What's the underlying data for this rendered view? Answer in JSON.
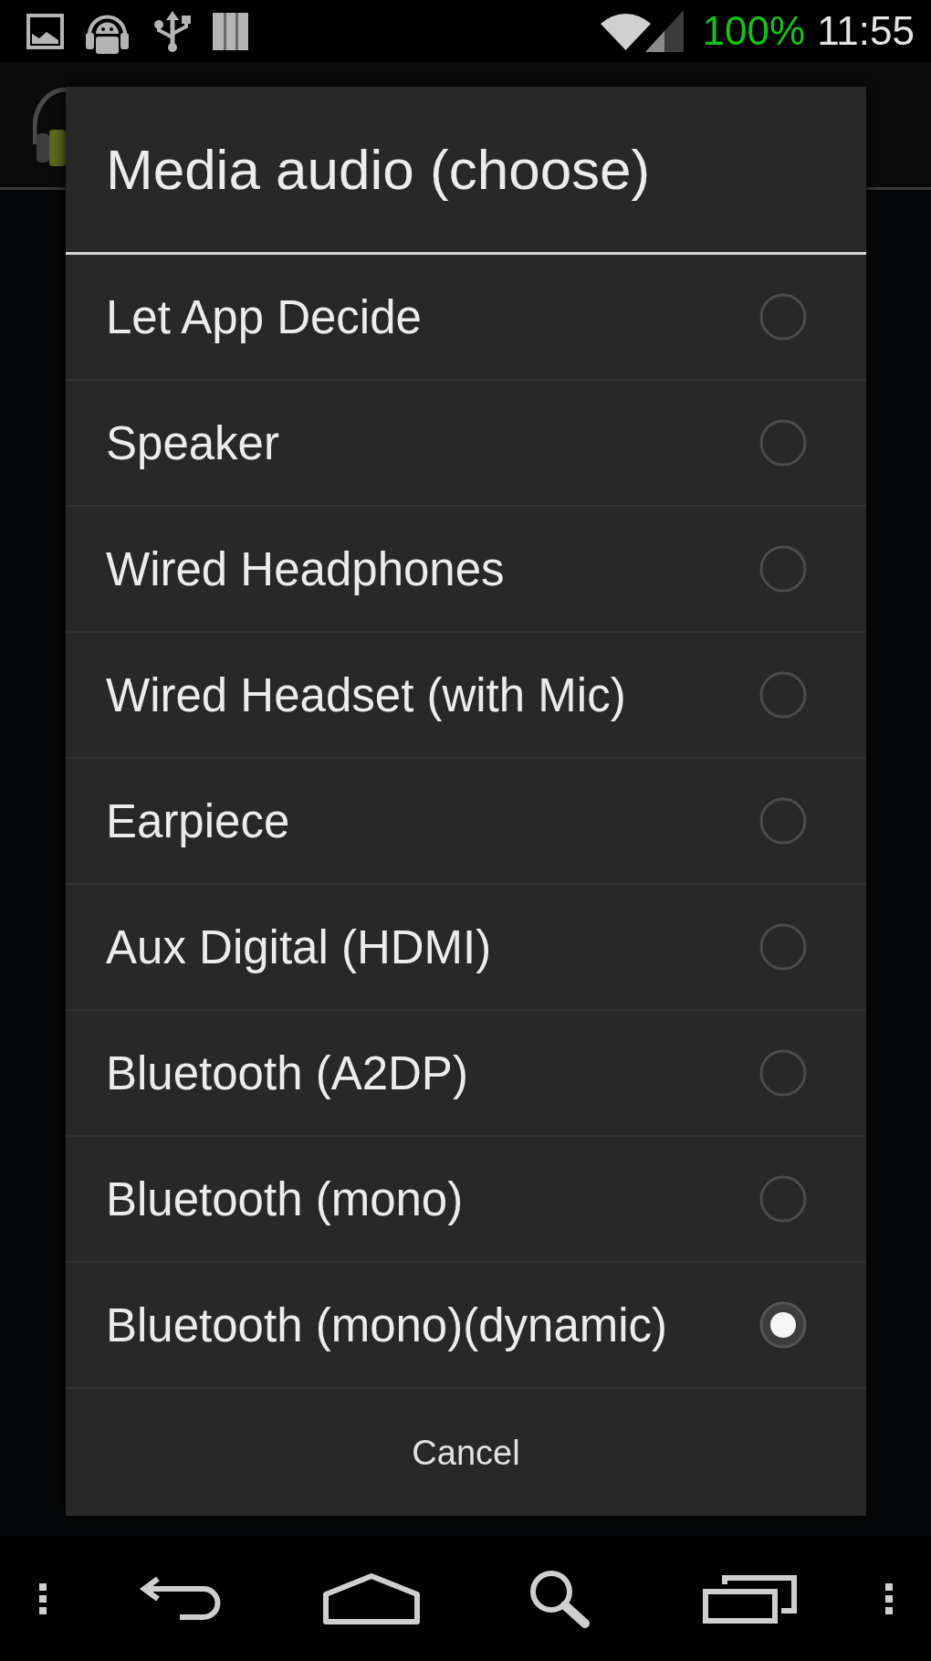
{
  "status_bar": {
    "battery": "100%",
    "time": "11:55"
  },
  "dialog": {
    "title": "Media audio (choose)",
    "options": [
      {
        "label": "Let App Decide",
        "selected": false
      },
      {
        "label": "Speaker",
        "selected": false
      },
      {
        "label": "Wired Headphones",
        "selected": false
      },
      {
        "label": "Wired Headset (with Mic)",
        "selected": false
      },
      {
        "label": "Earpiece",
        "selected": false
      },
      {
        "label": "Aux Digital (HDMI)",
        "selected": false
      },
      {
        "label": "Bluetooth (A2DP)",
        "selected": false
      },
      {
        "label": "Bluetooth (mono)",
        "selected": false
      },
      {
        "label": "Bluetooth (mono)(dynamic)",
        "selected": true
      }
    ],
    "cancel_button": "Cancel"
  }
}
